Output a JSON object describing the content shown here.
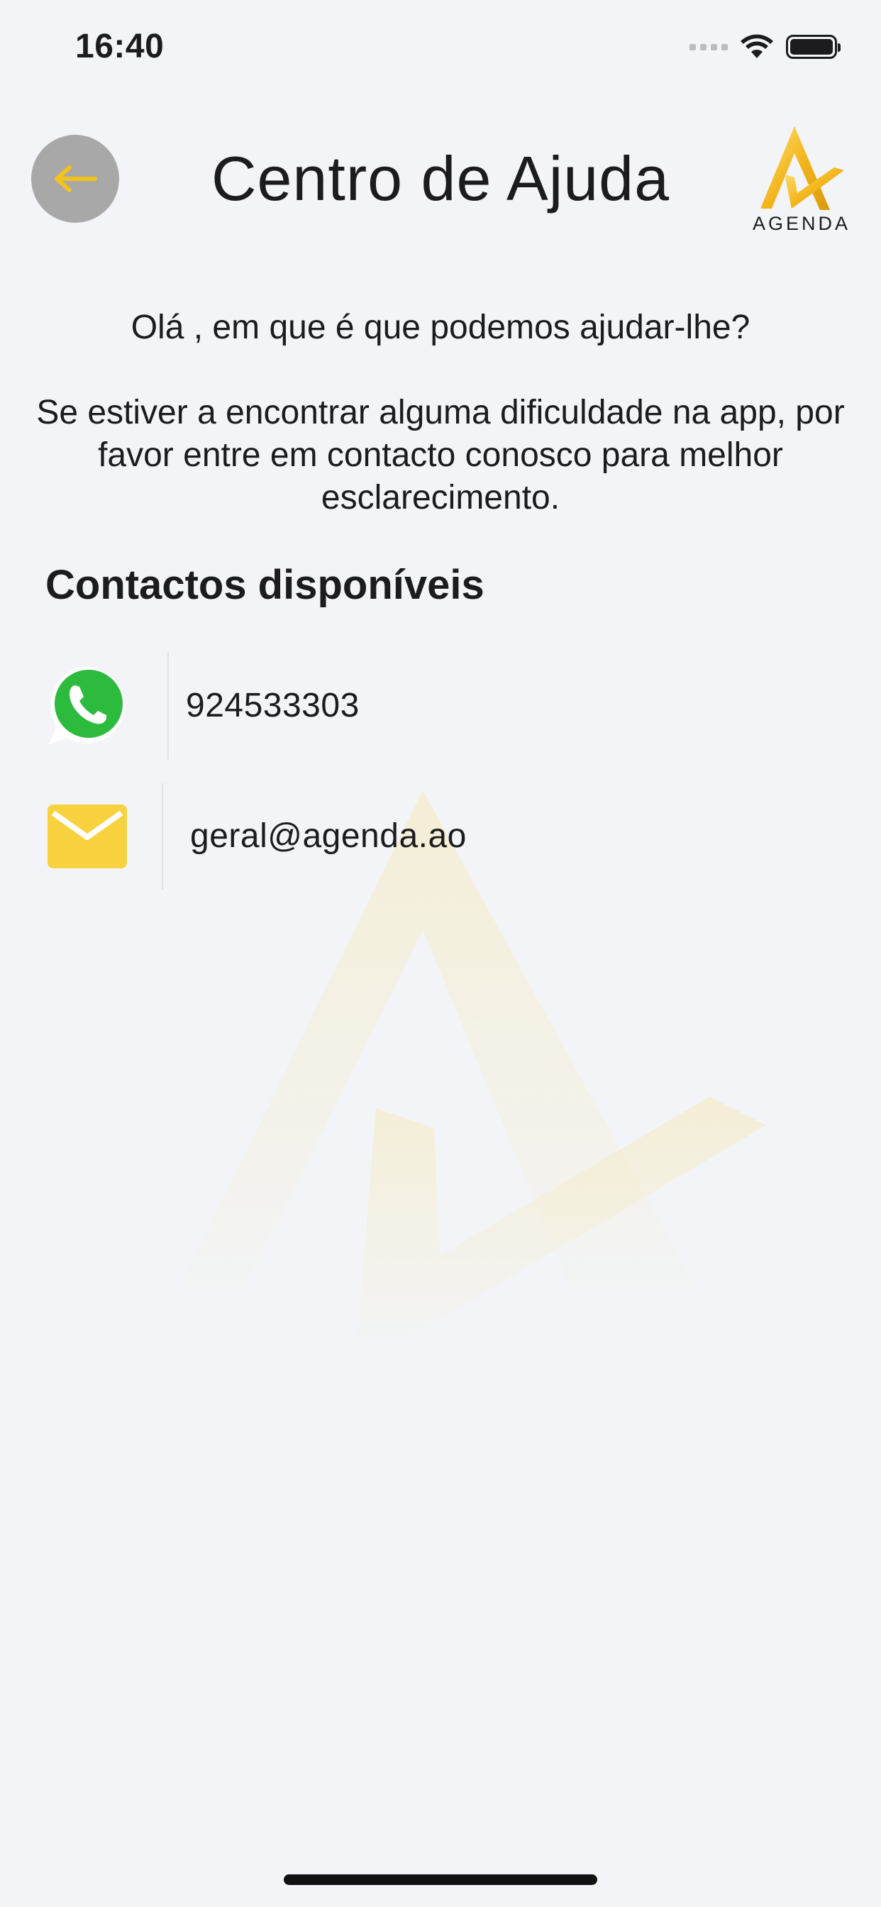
{
  "status_bar": {
    "time": "16:40",
    "icons": [
      "signal-icon",
      "wifi-icon",
      "battery-icon"
    ]
  },
  "header": {
    "title": "Centro de Ajuda",
    "back_icon": "arrow-left-icon",
    "logo_text": "AGENDA"
  },
  "content": {
    "greeting": "Olá  , em que é que podemos ajudar-lhe?",
    "intro": "Se estiver a encontrar alguma dificuldade na app, por favor entre em contacto conosco para melhor esclarecimento.",
    "contacts_title": "Contactos disponíveis",
    "contacts": [
      {
        "type": "whatsapp",
        "icon": "whatsapp-icon",
        "value": "924533303"
      },
      {
        "type": "email",
        "icon": "mail-icon",
        "value": "geral@agenda.ao"
      }
    ]
  },
  "colors": {
    "accent": "#f4c21a",
    "background": "#f2f4f7",
    "back_button": "#a8a8a8",
    "whatsapp_green": "#2dbb3e",
    "mail_yellow": "#f7d23e"
  }
}
